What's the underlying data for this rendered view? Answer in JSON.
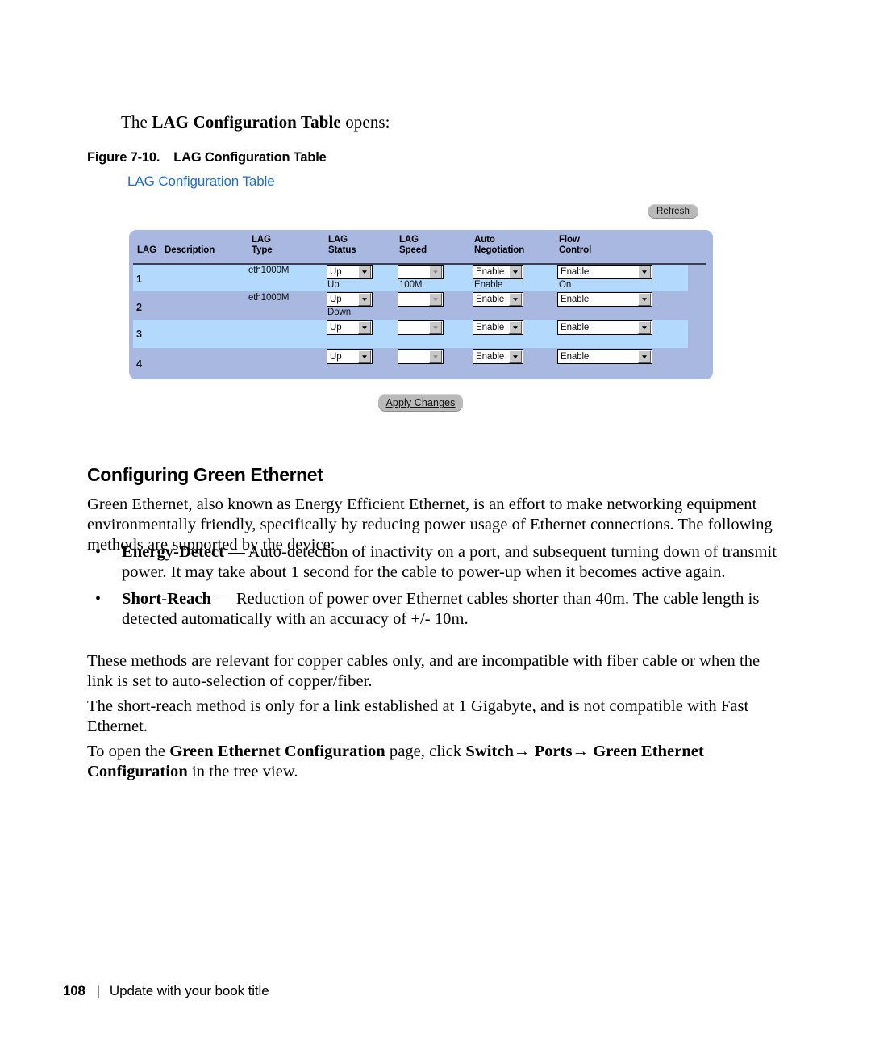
{
  "intro": {
    "prefix": "The ",
    "emphasis": "LAG Configuration Table",
    "suffix": " opens:"
  },
  "figure": {
    "number": "Figure 7-10.",
    "title": "LAG Configuration Table"
  },
  "screenshot": {
    "page_title": "LAG Configuration Table",
    "refresh_button": "Refresh",
    "apply_button": "Apply Changes",
    "table": {
      "headers": {
        "lag": "LAG",
        "description": "Description",
        "lag_type": "LAG\nType",
        "lag_status": "LAG\nStatus",
        "lag_speed": "LAG\nSpeed",
        "auto_negotiation": "Auto\nNegotiation",
        "flow_control": "Flow\nControl"
      },
      "rows": [
        {
          "lag": "1",
          "description": "",
          "lag_type": "eth1000M",
          "status_select": "Up",
          "status_current": "Up",
          "speed_select": "",
          "speed_current": "100M",
          "auto_select": "Enable",
          "auto_current": "Enable",
          "flow_select": "Enable",
          "flow_current": "On"
        },
        {
          "lag": "2",
          "description": "",
          "lag_type": "eth1000M",
          "status_select": "Up",
          "status_current": "Down",
          "speed_select": "",
          "speed_current": "",
          "auto_select": "Enable",
          "auto_current": "",
          "flow_select": "Enable",
          "flow_current": ""
        },
        {
          "lag": "3",
          "description": "",
          "lag_type": "",
          "status_select": "Up",
          "status_current": "",
          "speed_select": "",
          "speed_current": "",
          "auto_select": "Enable",
          "auto_current": "",
          "flow_select": "Enable",
          "flow_current": ""
        },
        {
          "lag": "4",
          "description": "",
          "lag_type": "",
          "status_select": "Up",
          "status_current": "",
          "speed_select": "",
          "speed_current": "",
          "auto_select": "Enable",
          "auto_current": "",
          "flow_select": "Enable",
          "flow_current": ""
        }
      ]
    }
  },
  "section": {
    "heading": "Configuring Green Ethernet",
    "paragraph_1": "Green Ethernet, also known as Energy Efficient Ethernet, is an effort to make networking equipment environmentally friendly, specifically by reducing power usage of Ethernet connections. The following methods are supported by the device:",
    "bullets": [
      {
        "marker": "•",
        "lead": "Energy-Detect",
        "text": " — Auto-detection of inactivity on a port, and subsequent turning down of transmit power. It may take about 1 second for the cable to power-up when it becomes active again."
      },
      {
        "marker": "•",
        "lead": "Short-Reach",
        "text": " — Reduction of power over Ethernet cables shorter than 40m. The cable length is detected automatically with an accuracy of +/- 10m."
      }
    ],
    "paragraph_2": "These methods are relevant for copper cables only, and are incompatible with fiber cable or when the link is set to auto-selection of copper/fiber.",
    "paragraph_3": "The short-reach method is only for a link established at 1 Gigabyte, and is not compatible with Fast Ethernet.",
    "paragraph_4_part1": "To open the ",
    "paragraph_4_bold1": "Green Ethernet Configuration",
    "paragraph_4_part2": " page, click ",
    "paragraph_4_bold2": "Switch→ Ports→ Green Ethernet Configuration",
    "paragraph_4_part3": " in the tree view."
  },
  "footer": {
    "page_number": "108",
    "separator": "|",
    "text": "Update with your book title"
  },
  "colors": {
    "link_blue": "#1f6fd0",
    "panel_base": "#a9b8e0",
    "row_stripe": "#b3dafc",
    "header_rule": "#3b3f55",
    "button_face": "#b9b9b9"
  }
}
